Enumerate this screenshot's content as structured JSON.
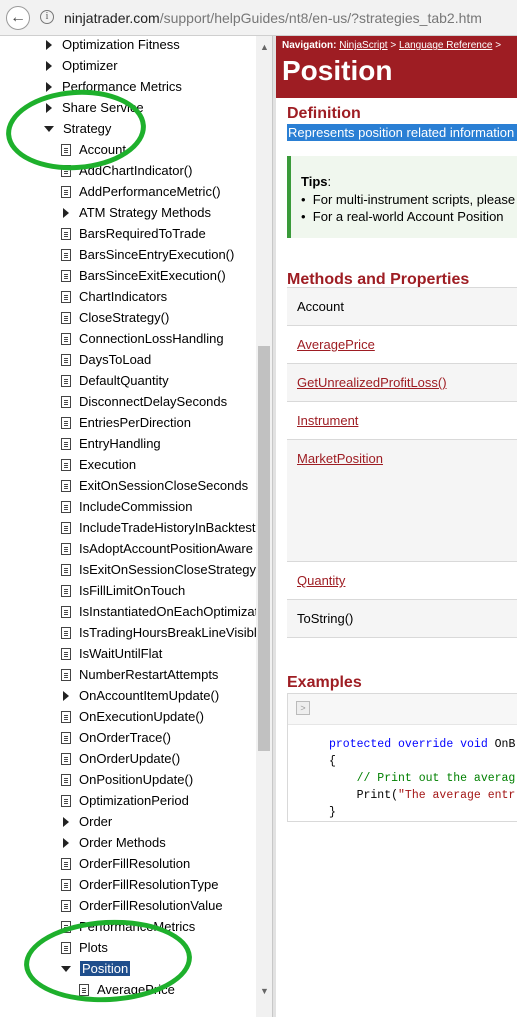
{
  "browser": {
    "url_host": "ninjatrader.com",
    "url_path": "/support/helpGuides/nt8/en-us/?strategies_tab2.htm"
  },
  "toc": {
    "items": [
      {
        "label": "Optimization Fitness",
        "icon": "arrow-right",
        "level": 1
      },
      {
        "label": "Optimizer",
        "icon": "arrow-right",
        "level": 1
      },
      {
        "label": "Performance Metrics",
        "icon": "arrow-right",
        "level": 1
      },
      {
        "label": "Share Service",
        "icon": "arrow-right",
        "level": 1
      },
      {
        "label": "Strategy",
        "icon": "arrow-down",
        "level": 1
      },
      {
        "label": "Account",
        "icon": "page",
        "level": 2
      },
      {
        "label": "AddChartIndicator()",
        "icon": "page",
        "level": 2
      },
      {
        "label": "AddPerformanceMetric()",
        "icon": "page",
        "level": 2
      },
      {
        "label": "ATM Strategy Methods",
        "icon": "arrow-right",
        "level": 2
      },
      {
        "label": "BarsRequiredToTrade",
        "icon": "page",
        "level": 2
      },
      {
        "label": "BarsSinceEntryExecution()",
        "icon": "page",
        "level": 2
      },
      {
        "label": "BarsSinceExitExecution()",
        "icon": "page",
        "level": 2
      },
      {
        "label": "ChartIndicators",
        "icon": "page",
        "level": 2
      },
      {
        "label": "CloseStrategy()",
        "icon": "page",
        "level": 2
      },
      {
        "label": "ConnectionLossHandling",
        "icon": "page",
        "level": 2
      },
      {
        "label": "DaysToLoad",
        "icon": "page",
        "level": 2
      },
      {
        "label": "DefaultQuantity",
        "icon": "page",
        "level": 2
      },
      {
        "label": "DisconnectDelaySeconds",
        "icon": "page",
        "level": 2
      },
      {
        "label": "EntriesPerDirection",
        "icon": "page",
        "level": 2
      },
      {
        "label": "EntryHandling",
        "icon": "page",
        "level": 2
      },
      {
        "label": "Execution",
        "icon": "page",
        "level": 2
      },
      {
        "label": "ExitOnSessionCloseSeconds",
        "icon": "page",
        "level": 2
      },
      {
        "label": "IncludeCommission",
        "icon": "page",
        "level": 2
      },
      {
        "label": "IncludeTradeHistoryInBacktest",
        "icon": "page",
        "level": 2
      },
      {
        "label": "IsAdoptAccountPositionAware",
        "icon": "page",
        "level": 2
      },
      {
        "label": "IsExitOnSessionCloseStrategy",
        "icon": "page",
        "level": 2
      },
      {
        "label": "IsFillLimitOnTouch",
        "icon": "page",
        "level": 2
      },
      {
        "label": "IsInstantiatedOnEachOptimizationIteration",
        "icon": "page",
        "level": 2
      },
      {
        "label": "IsTradingHoursBreakLineVisible",
        "icon": "page",
        "level": 2
      },
      {
        "label": "IsWaitUntilFlat",
        "icon": "page",
        "level": 2
      },
      {
        "label": "NumberRestartAttempts",
        "icon": "page",
        "level": 2
      },
      {
        "label": "OnAccountItemUpdate()",
        "icon": "arrow-right",
        "level": 2
      },
      {
        "label": "OnExecutionUpdate()",
        "icon": "page",
        "level": 2
      },
      {
        "label": "OnOrderTrace()",
        "icon": "page",
        "level": 2
      },
      {
        "label": "OnOrderUpdate()",
        "icon": "page",
        "level": 2
      },
      {
        "label": "OnPositionUpdate()",
        "icon": "page",
        "level": 2
      },
      {
        "label": "OptimizationPeriod",
        "icon": "page",
        "level": 2
      },
      {
        "label": "Order",
        "icon": "arrow-right",
        "level": 2
      },
      {
        "label": "Order Methods",
        "icon": "arrow-right",
        "level": 2
      },
      {
        "label": "OrderFillResolution",
        "icon": "page",
        "level": 2
      },
      {
        "label": "OrderFillResolutionType",
        "icon": "page",
        "level": 2
      },
      {
        "label": "OrderFillResolutionValue",
        "icon": "page",
        "level": 2
      },
      {
        "label": "PerformanceMetrics",
        "icon": "page",
        "level": 2
      },
      {
        "label": "Plots",
        "icon": "page",
        "level": 2
      },
      {
        "label": "Position",
        "icon": "arrow-down",
        "level": 2,
        "selected": true
      },
      {
        "label": "AveragePrice",
        "icon": "page",
        "level": 3
      }
    ]
  },
  "nav": {
    "prefix": "Navigation:",
    "crumb1": "NinjaScript",
    "sep": ">",
    "crumb2": "Language Reference",
    "sep2": ">"
  },
  "page": {
    "title": "Position",
    "definition_heading": "Definition",
    "definition_text": "Represents position related information",
    "tips_title": "Tips",
    "tips": [
      "For multi-instrument scripts, please",
      "For a real-world Account Position"
    ],
    "methods_heading": "Methods and Properties",
    "methods": [
      {
        "label": "Account",
        "link": false
      },
      {
        "label": "AveragePrice",
        "link": true
      },
      {
        "label": "GetUnrealizedProfitLoss()",
        "link": true
      },
      {
        "label": "Instrument",
        "link": true
      },
      {
        "label": "MarketPosition",
        "link": true
      },
      {
        "label": "Quantity",
        "link": true
      },
      {
        "label": "ToString()",
        "link": false
      }
    ],
    "examples_heading": "Examples",
    "code": {
      "line1_kw": "protected override void",
      "line1_rest": " OnB",
      "line2": "{",
      "line3_comment": "    // Print out the averag",
      "line4_pre": "    Print(",
      "line4_str": "\"The average entr",
      "line5": "}"
    }
  },
  "colors": {
    "accent": "#9e1d23",
    "selection": "#2a7fd4",
    "annotation": "#1eb02c"
  }
}
